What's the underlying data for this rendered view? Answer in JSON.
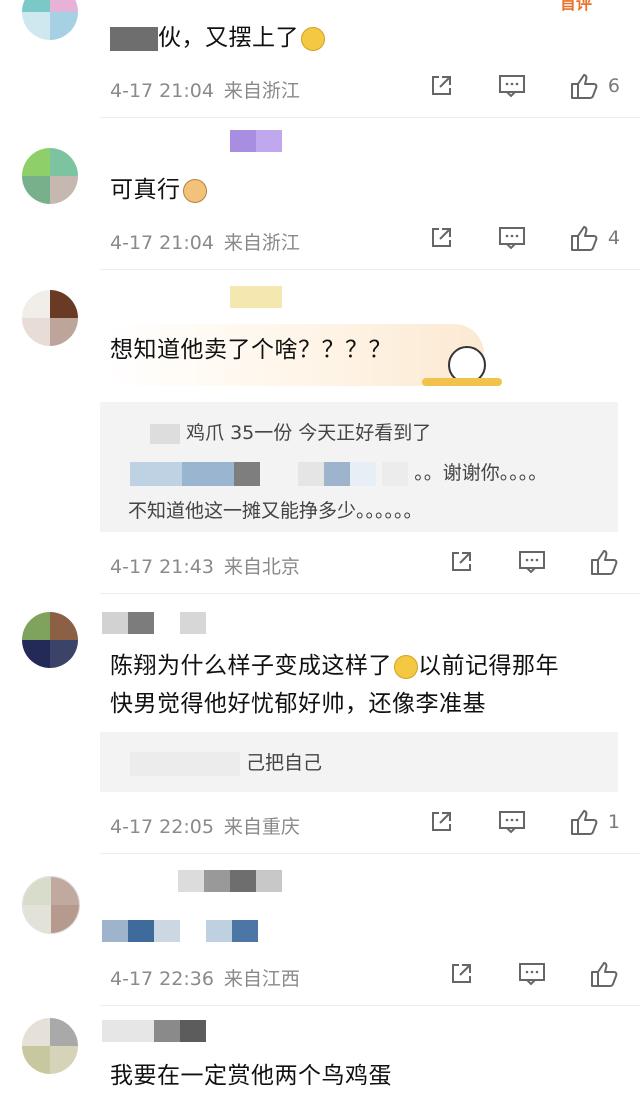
{
  "comments": [
    {
      "text": "伙，又摆上了",
      "time": "4-17 21:04",
      "location": "来自浙江",
      "likes": "6"
    },
    {
      "text": "可真行",
      "time": "4-17 21:04",
      "location": "来自浙江",
      "likes": "4"
    },
    {
      "text": "想知道他卖了个啥？？？？",
      "time": "4-17 21:43",
      "location": "来自北京",
      "likes": "",
      "replies": [
        "鸡爪 35一份 今天正好看到了",
        "。。谢谢你。。。。",
        "不知道他这一摊又能挣多少。。。。。。"
      ]
    },
    {
      "text_line1": "陈翔为什么样子变成这样了",
      "text_line1_b": "以前记得那年",
      "text_line2": "快男觉得他好忧郁好帅，还像李准基",
      "time": "4-17 22:05",
      "location": "来自重庆",
      "likes": "1",
      "replies": [
        "己把自己"
      ]
    },
    {
      "text": "",
      "time": "4-17 22:36",
      "location": "来自江西",
      "likes": ""
    },
    {
      "text": "我要在一定赏他两个鸟鸡蛋"
    }
  ],
  "top_badge": "首评",
  "icons": [
    "share-icon",
    "comment-icon",
    "like-icon"
  ]
}
